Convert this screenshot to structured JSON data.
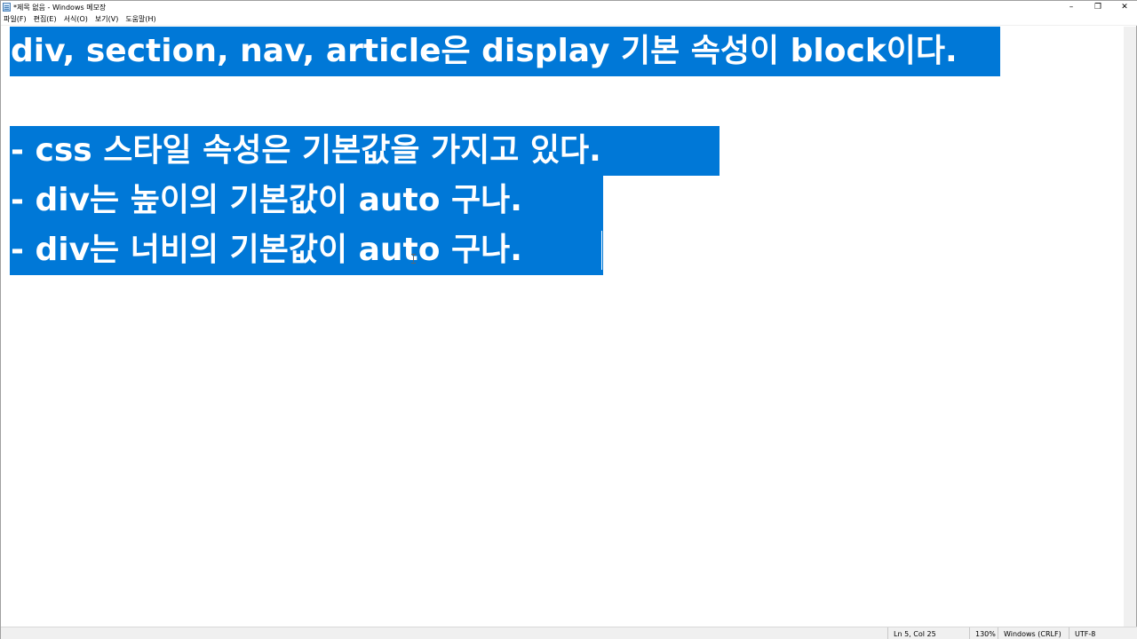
{
  "window": {
    "title": "*제목 없음 - Windows 메모장",
    "minimize_glyph": "–",
    "restore_glyph": "❐",
    "close_glyph": "✕"
  },
  "menu": {
    "items": [
      {
        "label": "파일(F)"
      },
      {
        "label": "편집(E)"
      },
      {
        "label": "서식(O)"
      },
      {
        "label": "보기(V)"
      },
      {
        "label": "도움말(H)"
      }
    ]
  },
  "editor": {
    "lines": [
      "div, section, nav, article은 display 기본 속성이 block이다.",
      "",
      "- css 스타일 속성은 기본값을 가지고 있다.",
      "- div는 높이의 기본값이 auto 구나.",
      "- div는 너비의 기본값이 auto 구나."
    ],
    "selection_color": "#0078d7"
  },
  "status": {
    "position": "Ln 5, Col 25",
    "zoom": "130%",
    "line_ending": "Windows (CRLF)",
    "encoding": "UTF-8"
  }
}
